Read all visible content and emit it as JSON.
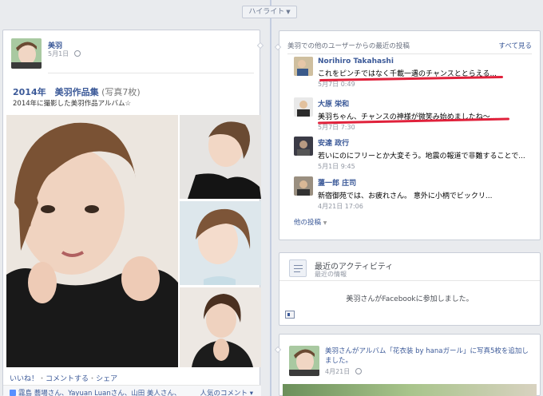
{
  "highlight": {
    "label": "ハイライト"
  },
  "left_post": {
    "author": "美羽",
    "date": "5月1日",
    "album_title": "2014年　美羽作品集",
    "album_count": "(写真7枚)",
    "album_desc": "2014年に撮影した美羽作品アルバム☆",
    "actions": {
      "like": "いいね！",
      "comment": "コメントする",
      "share": "シェア",
      "sep": "・"
    },
    "likes_text": "霧島 蕎場さん、Yayuan Luanさん、山田 美人さん、",
    "popular_comments": "人気のコメント ▾"
  },
  "recent_posts": {
    "title": "美羽での他のユーザーからの最近の投稿",
    "see_all": "すべて見る",
    "items": [
      {
        "name": "Norihiro Takahashi",
        "text": "これをピンチではなく千載一遇のチャンスととらえる...",
        "time": "5月7日 0:49"
      },
      {
        "name": "大原 栄和",
        "text": "美羽ちゃん、チャンスの神様が微笑み始めましたね～...",
        "time": "5月7日 7:30"
      },
      {
        "name": "安達 政行",
        "text": "若いにのにフリーとか大変そう。地震の報道で非難することで...",
        "time": "5月1日 9:45"
      },
      {
        "name": "蘯一郎 庄司",
        "text": "新宿御苑では、お疲れさん。 意外に小柄でビックリ...",
        "time": "4月21日 17:06"
      }
    ],
    "more": "他の投稿"
  },
  "activity": {
    "title": "最近のアクティビティ",
    "subtitle": "最近の情報",
    "joined": "美羽さんがFacebookに参加しました。"
  },
  "album_update": {
    "text": "美羽さんがアルバム「花衣装 by hanaガール」に写真5枚を追加しました。",
    "date": "4月21日"
  },
  "colors": {
    "link": "#3b5998",
    "underline": "#e0213b",
    "timeline": "#c4cde0"
  }
}
